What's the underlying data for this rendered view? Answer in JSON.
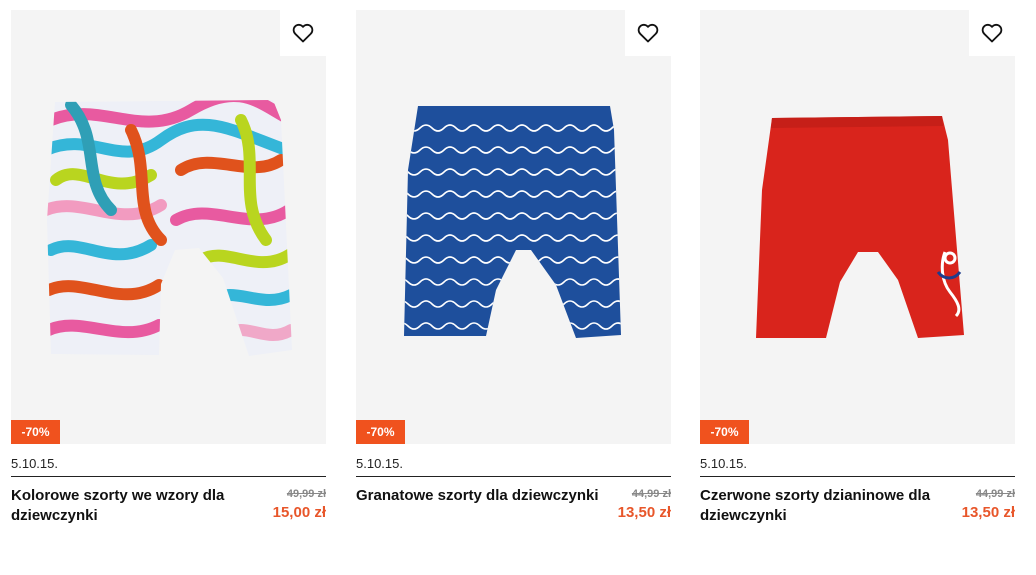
{
  "products": [
    {
      "badge": "-70%",
      "brand": "5.10.15.",
      "name": "Kolorowe szorty we wzory dla dziewczynki",
      "old_price": "49,99 zł",
      "new_price": "15,00 zł",
      "image": "multicolor-pattern-shorts"
    },
    {
      "badge": "-70%",
      "brand": "5.10.15.",
      "name": "Granatowe szorty dla dziewczynki",
      "old_price": "44,99 zł",
      "new_price": "13,50 zł",
      "image": "navy-wave-pattern-shorts"
    },
    {
      "badge": "-70%",
      "brand": "5.10.15.",
      "name": "Czerwone szorty dzianinowe dla dziewczynki",
      "old_price": "44,99 zł",
      "new_price": "13,50 zł",
      "image": "red-knit-shorts"
    }
  ],
  "colors": {
    "badge": "#f0521e",
    "sale_price": "#e8562a",
    "image_bg": "#f4f4f4"
  }
}
